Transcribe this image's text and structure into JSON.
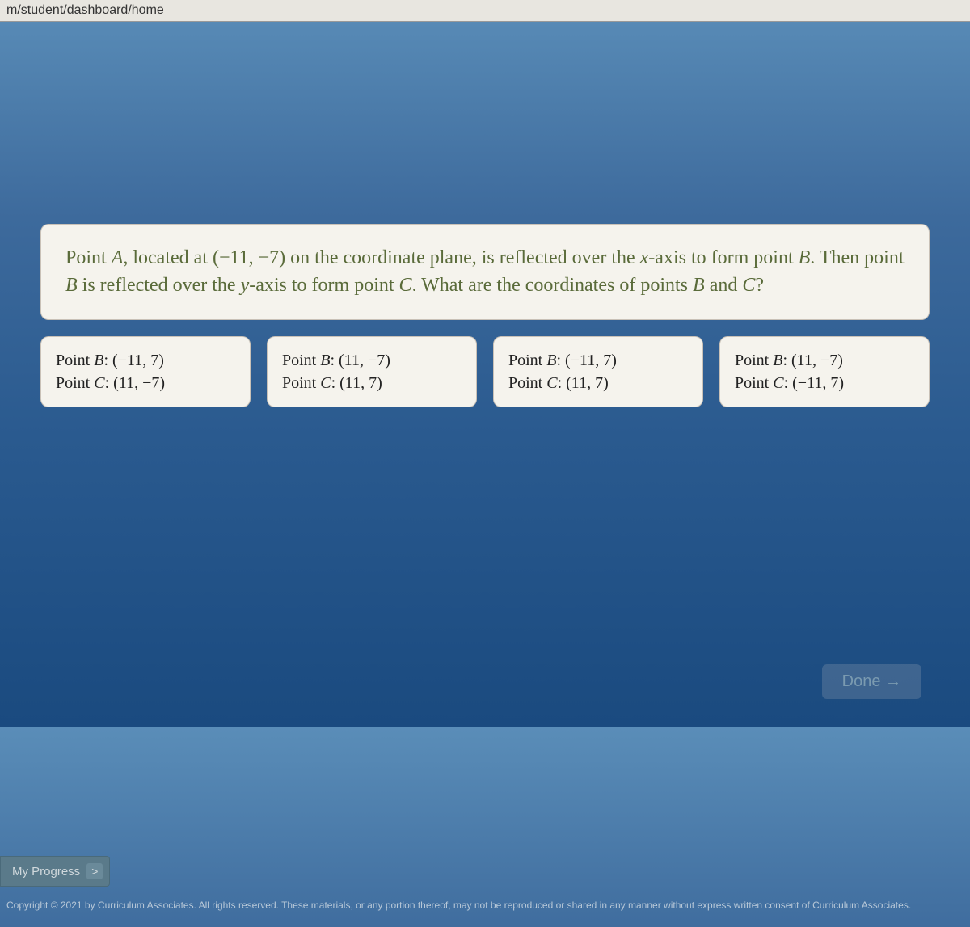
{
  "url": "m/student/dashboard/home",
  "question": {
    "prefix": "Point ",
    "varA": "A",
    "locatedAt": ", located at ",
    "pointA_coords": "(−11, −7)",
    "mid1": " on the coordinate plane, is reflected over the ",
    "xaxis": "x",
    "mid2": "-axis to form point ",
    "varB1": "B",
    "mid3": ". Then point ",
    "varB2": "B",
    "mid4": " is reflected over the ",
    "yaxis": "y",
    "mid5": "-axis to form point ",
    "varC": "C",
    "mid6": ". What are the coordinates of points ",
    "varB3": "B",
    "and": " and ",
    "varC2": "C",
    "end": "?"
  },
  "options": [
    {
      "lineB_label": "Point ",
      "lineB_var": "B",
      "lineB_coords": ": (−11, 7)",
      "lineC_label": "Point ",
      "lineC_var": "C",
      "lineC_coords": ": (11, −7)"
    },
    {
      "lineB_label": "Point ",
      "lineB_var": "B",
      "lineB_coords": ": (11, −7)",
      "lineC_label": "Point ",
      "lineC_var": "C",
      "lineC_coords": ": (11, 7)"
    },
    {
      "lineB_label": "Point ",
      "lineB_var": "B",
      "lineB_coords": ": (−11, 7)",
      "lineC_label": "Point ",
      "lineC_var": "C",
      "lineC_coords": ": (11, 7)"
    },
    {
      "lineB_label": "Point ",
      "lineB_var": "B",
      "lineB_coords": ": (11, −7)",
      "lineC_label": "Point ",
      "lineC_var": "C",
      "lineC_coords": ": (−11, 7)"
    }
  ],
  "buttons": {
    "done": "Done",
    "progress": "My Progress",
    "progress_chevron": ">"
  },
  "copyright": "Copyright © 2021 by Curriculum Associates. All rights reserved. These materials, or any portion thereof, may not be reproduced or shared in any manner without express written consent of Curriculum Associates."
}
